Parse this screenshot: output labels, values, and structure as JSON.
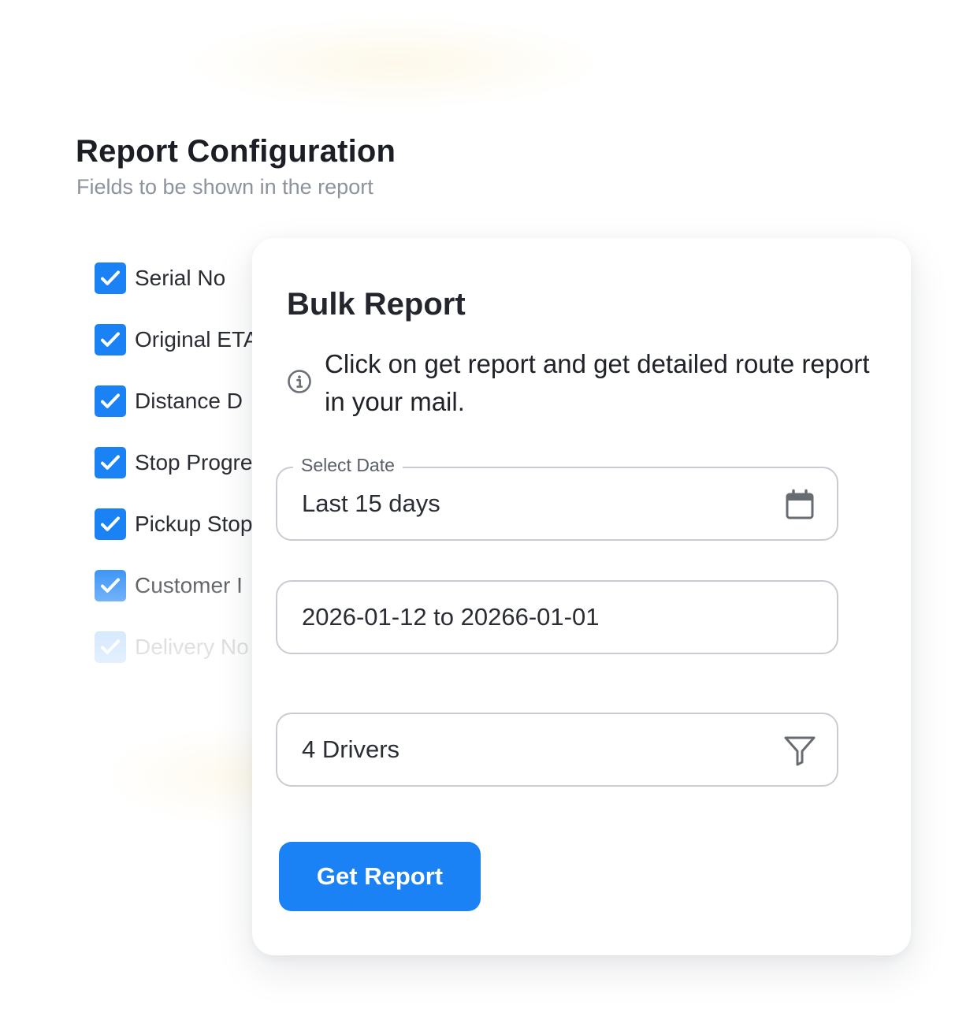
{
  "config": {
    "title": "Report Configuration",
    "subtitle": "Fields to be shown in the report",
    "fields": [
      {
        "label": "Serial No",
        "checked": true
      },
      {
        "label": "Original ETA",
        "checked": true
      },
      {
        "label": "Distance D",
        "checked": true
      },
      {
        "label": "Stop Progre",
        "checked": true
      },
      {
        "label": "Pickup Stop",
        "checked": true
      },
      {
        "label": "Customer I",
        "checked": true
      },
      {
        "label": "Delivery No",
        "checked": true
      }
    ]
  },
  "bulk_report": {
    "title": "Bulk Report",
    "info_icon": "info-circle-icon",
    "info_text": "Click on get report and get detailed route report in your mail.",
    "date_select": {
      "label": "Select Date",
      "value": "Last 15 days",
      "icon": "calendar-icon"
    },
    "date_range": {
      "value": "2026-01-12 to  20266-01-01"
    },
    "driver_filter": {
      "value": "4 Drivers",
      "icon": "filter-icon"
    },
    "button_label": "Get Report"
  },
  "colors": {
    "accent": "#1a82f5",
    "title": "#1b1e24",
    "subtitle": "#8c939e",
    "border": "#c9ccd2"
  }
}
